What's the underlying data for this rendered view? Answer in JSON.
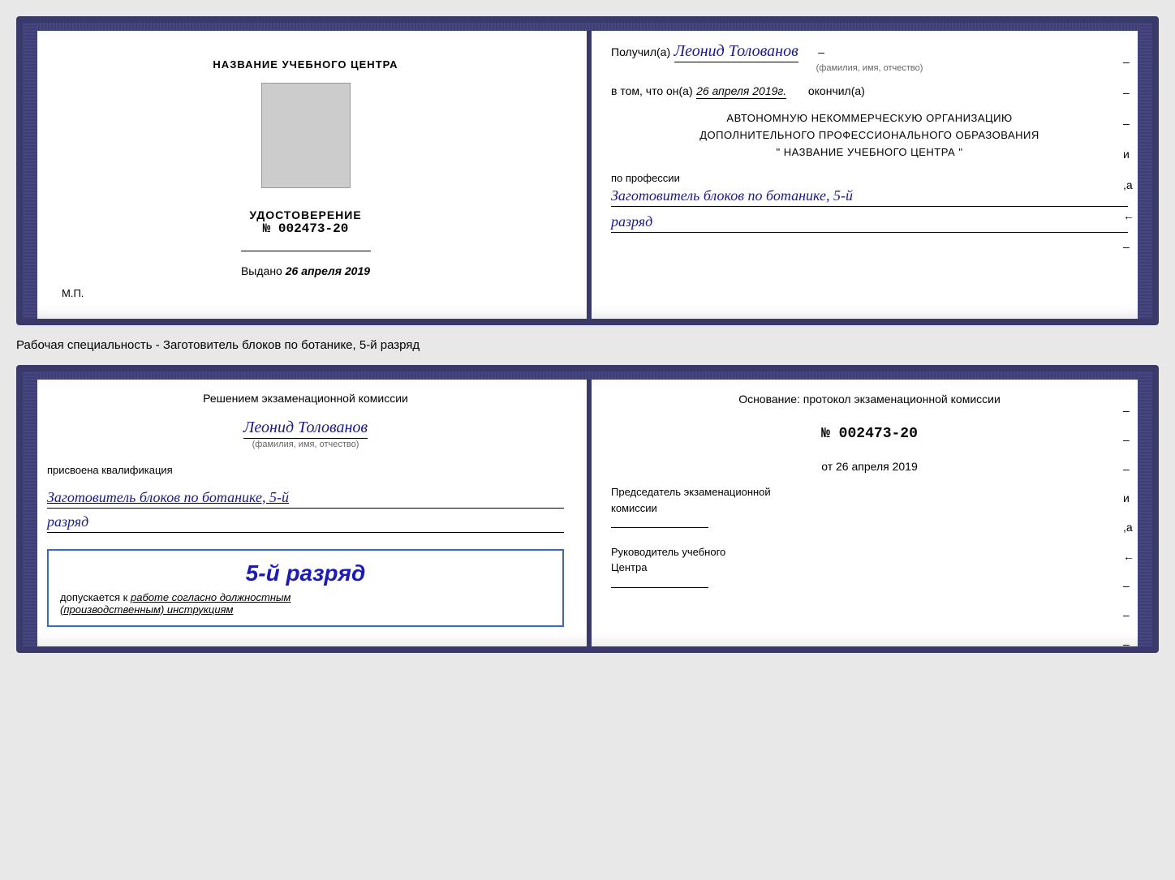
{
  "topCert": {
    "left": {
      "title": "НАЗВАНИЕ УЧЕБНОГО ЦЕНТРА",
      "photoAlt": "photo",
      "udostoverenie": "УДОСТОВЕРЕНИЕ",
      "number": "№ 002473-20",
      "vydano_label": "Выдано",
      "vydano_date": "26 апреля 2019",
      "mp": "М.П."
    },
    "right": {
      "poluchil_prefix": "Получил(а)",
      "recipient_name": "Леонид Толованов",
      "fio_subtitle": "(фамилия, имя, отчество)",
      "vtom_prefix": "в том, что он(а)",
      "vtom_date": "26 апреля 2019г.",
      "okonchil": "окончил(а)",
      "org_line1": "АВТОНОМНУЮ НЕКОММЕРЧЕСКУЮ ОРГАНИЗАЦИЮ",
      "org_line2": "ДОПОЛНИТЕЛЬНОГО ПРОФЕССИОНАЛЬНОГО ОБРАЗОВАНИЯ",
      "org_line3": "\" НАЗВАНИЕ УЧЕБНОГО ЦЕНТРА \"",
      "po_professii": "по профессии",
      "profession": "Заготовитель блоков по ботанике, 5-й",
      "razryad": "разряд",
      "dashes": [
        "-",
        "-",
        "-",
        "и",
        ",а",
        "←",
        "-"
      ]
    }
  },
  "middleLabel": "Рабочая специальность - Заготовитель блоков по ботанике, 5-й разряд",
  "bottomCert": {
    "left": {
      "resheniem_line1": "Решением  экзаменационной  комиссии",
      "person_name": "Леонид Толованов",
      "fio_subtitle": "(фамилия, имя, отчество)",
      "prisvoena": "присвоена квалификация",
      "qualification": "Заготовитель блоков по ботанике, 5-й",
      "razryad_text": "разряд",
      "badge_text": "5-й разряд",
      "dopuskaetsya_label": "допускается к",
      "dopuskaetsya_text": " работе согласно должностным",
      "instruktsii": "(производственным) инструкциям"
    },
    "right": {
      "osnovanie": "Основание: протокол экзаменационной  комиссии",
      "protocol_number": "№  002473-20",
      "ot_prefix": "от",
      "ot_date": "26 апреля 2019",
      "chairman_line1": "Председатель экзаменационной",
      "chairman_line2": "комиссии",
      "rukovoditel_line1": "Руководитель учебного",
      "rukovoditel_line2": "Центра",
      "dashes": [
        "-",
        "-",
        "-",
        "и",
        ",а",
        "←",
        "-",
        "-",
        "-"
      ]
    }
  }
}
